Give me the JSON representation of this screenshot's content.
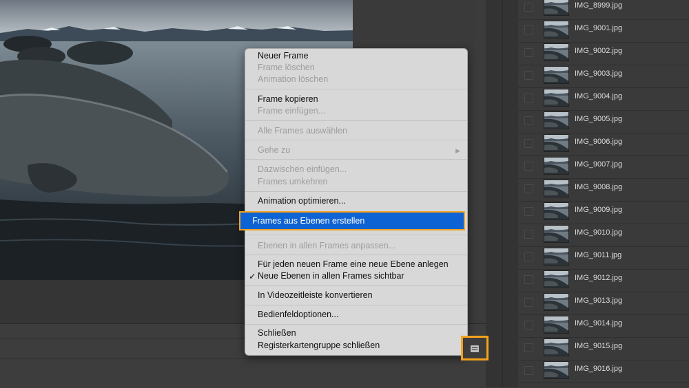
{
  "menu": {
    "items": [
      {
        "label": "Neuer Frame"
      },
      {
        "label": "Frame löschen"
      },
      {
        "label": "Animation löschen"
      },
      {
        "label": "Frame kopieren"
      },
      {
        "label": "Frame einfügen..."
      },
      {
        "label": "Alle Frames auswählen"
      },
      {
        "label": "Gehe zu"
      },
      {
        "label": "Dazwischen einfügen..."
      },
      {
        "label": "Frames umkehren"
      },
      {
        "label": "Animation optimieren..."
      },
      {
        "label": "Frames aus Ebenen erstellen"
      },
      {
        "label": "Ebenen in allen Frames anpassen..."
      },
      {
        "label": "Für jeden neuen Frame eine neue Ebene anlegen"
      },
      {
        "label": "Neue Ebenen in allen Frames sichtbar"
      },
      {
        "label": "In Videozeitleiste konvertieren"
      },
      {
        "label": "Bedienfeldoptionen..."
      },
      {
        "label": "Schließen"
      },
      {
        "label": "Registerkartengruppe schließen"
      }
    ],
    "check_glyph": "✓",
    "submenu_arrow": "▶",
    "highlight_color": "#0d63d4",
    "annotation_color": "#f5a21c"
  },
  "files": [
    "IMG_8999.jpg",
    "IMG_9001.jpg",
    "IMG_9002.jpg",
    "IMG_9003.jpg",
    "IMG_9004.jpg",
    "IMG_9005.jpg",
    "IMG_9006.jpg",
    "IMG_9007.jpg",
    "IMG_9008.jpg",
    "IMG_9009.jpg",
    "IMG_9010.jpg",
    "IMG_9011.jpg",
    "IMG_9012.jpg",
    "IMG_9013.jpg",
    "IMG_9014.jpg",
    "IMG_9015.jpg",
    "IMG_9016.jpg"
  ],
  "icons": {
    "panel_menu": "hamburger-menu-icon",
    "check": "checkmark-icon",
    "submenu": "submenu-arrow-icon"
  }
}
